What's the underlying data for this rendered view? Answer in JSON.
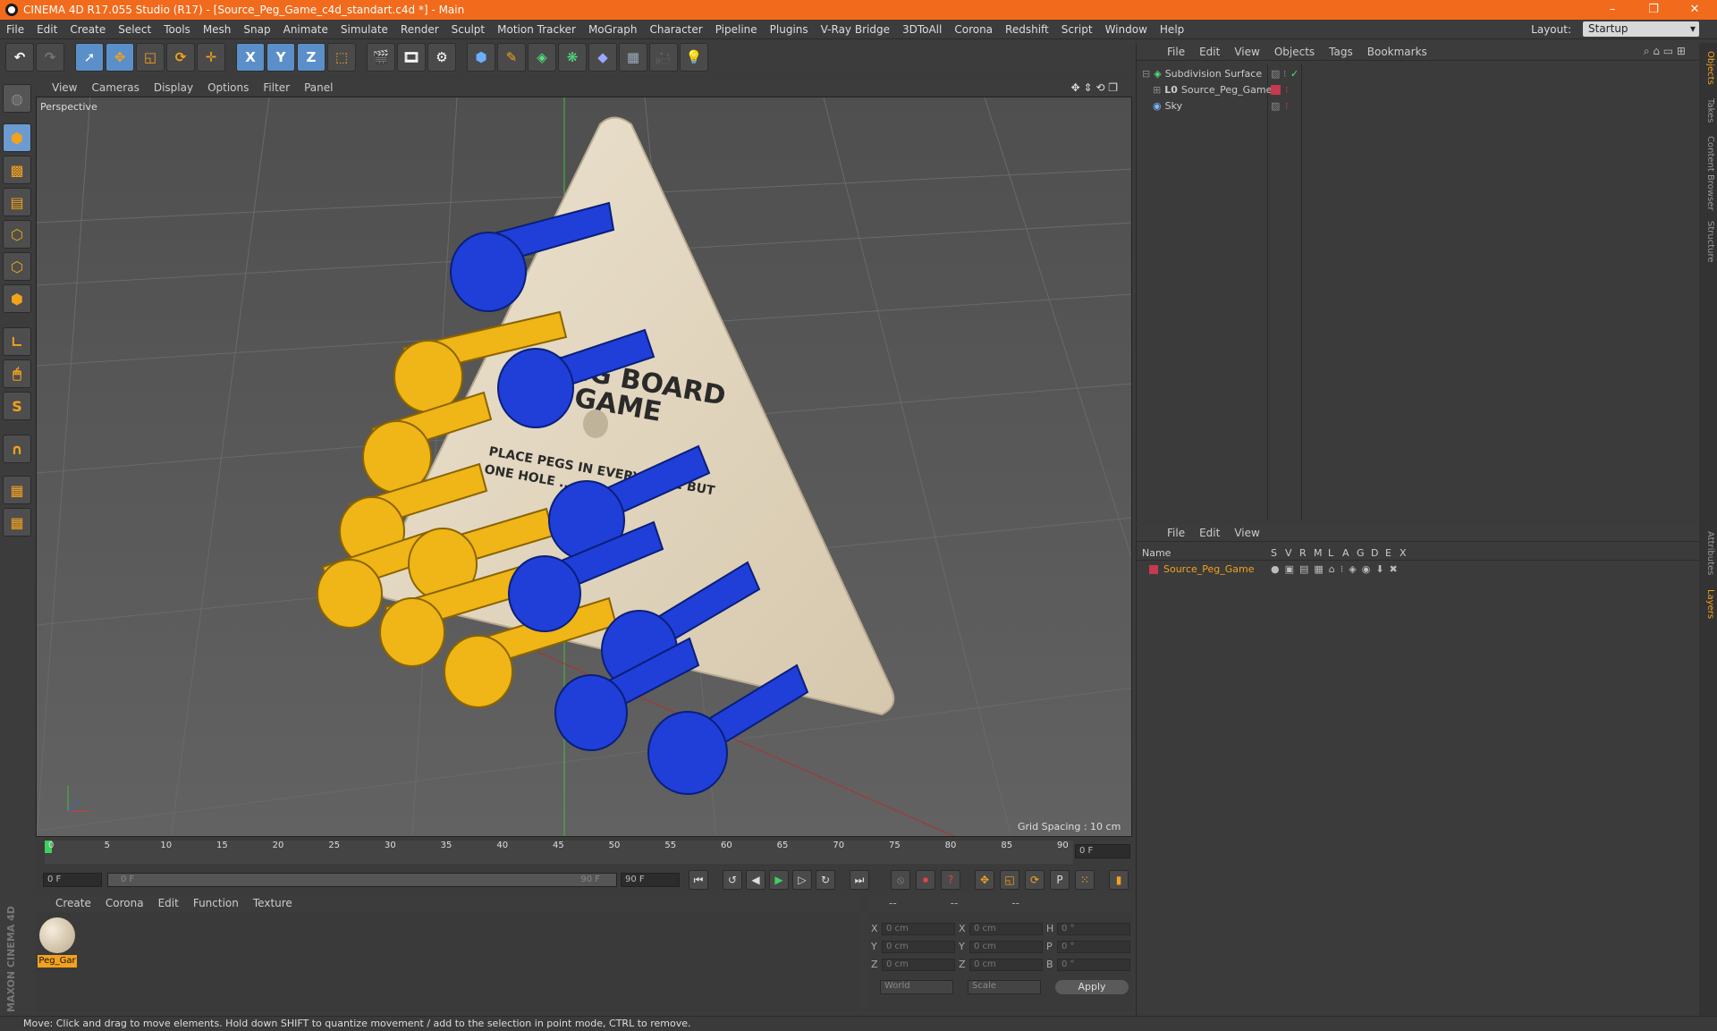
{
  "app": {
    "title": "CINEMA 4D R17.055 Studio (R17) - [Source_Peg_Game_c4d_standart.c4d *] - Main",
    "accent": "#f26a1b"
  },
  "menu": [
    "File",
    "Edit",
    "Create",
    "Select",
    "Tools",
    "Mesh",
    "Snap",
    "Animate",
    "Simulate",
    "Render",
    "Sculpt",
    "Motion Tracker",
    "MoGraph",
    "Character",
    "Pipeline",
    "Plugins",
    "V-Ray Bridge",
    "3DToAll",
    "Corona",
    "Redshift",
    "Script",
    "Window",
    "Help"
  ],
  "layout": {
    "label": "Layout:",
    "value": "Startup"
  },
  "toolbar": {
    "x": "X",
    "y": "Y",
    "z": "Z"
  },
  "viewport": {
    "menu": [
      "View",
      "Cameras",
      "Display",
      "Options",
      "Filter",
      "Panel"
    ],
    "label": "Perspective",
    "grid_spacing": "Grid Spacing : 10 cm",
    "board_text": [
      "PEG BOARD",
      "GAME",
      "PLACE PEGS IN EVERY HOLE BUT",
      "ONE HOLE ..."
    ]
  },
  "timeline": {
    "ticks": [
      "0",
      "5",
      "10",
      "15",
      "20",
      "25",
      "30",
      "35",
      "40",
      "45",
      "50",
      "55",
      "60",
      "65",
      "70",
      "75",
      "80",
      "85",
      "90"
    ],
    "current_frame": "0 F",
    "start": "0 F",
    "range_start": "0 F",
    "range_end": "90 F",
    "end": "90 F"
  },
  "material_menu": [
    "Create",
    "Corona",
    "Edit",
    "Function",
    "Texture"
  ],
  "material": {
    "name": "Peg_Gar"
  },
  "coords": {
    "headers": [
      "--",
      "--",
      "--"
    ],
    "rows": [
      {
        "l1": "X",
        "v1": "0 cm",
        "l2": "X",
        "v2": "0 cm",
        "l3": "H",
        "v3": "0 °"
      },
      {
        "l1": "Y",
        "v1": "0 cm",
        "l2": "Y",
        "v2": "0 cm",
        "l3": "P",
        "v3": "0 °"
      },
      {
        "l1": "Z",
        "v1": "0 cm",
        "l2": "Z",
        "v2": "0 cm",
        "l3": "B",
        "v3": "0 °"
      }
    ],
    "world": "World",
    "scale": "Scale",
    "apply": "Apply"
  },
  "objects_menu": [
    "File",
    "Edit",
    "View",
    "Objects",
    "Tags",
    "Bookmarks"
  ],
  "objects": [
    {
      "name": "Subdivision Surface",
      "indent": 0
    },
    {
      "name": "Source_Peg_Game",
      "indent": 1
    },
    {
      "name": "Sky",
      "indent": 0
    }
  ],
  "layers_menu": [
    "File",
    "Edit",
    "View"
  ],
  "layers": {
    "columns": [
      "Name",
      "S",
      "V",
      "R",
      "M",
      "L",
      "A",
      "G",
      "D",
      "E",
      "X"
    ],
    "rows": [
      {
        "name": "Source_Peg_Game",
        "color": "#c8384e"
      }
    ]
  },
  "right_tabs": [
    "Objects",
    "Takes",
    "Content Browser",
    "Structure",
    "Attributes",
    "Layers"
  ],
  "status": "Move: Click and drag to move elements. Hold down SHIFT to quantize movement / add to the selection in point mode, CTRL to remove.",
  "brand": "MAXON CINEMA 4D"
}
